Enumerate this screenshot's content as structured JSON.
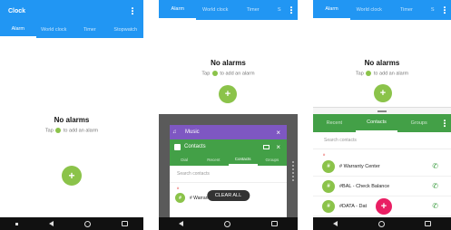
{
  "panel1": {
    "app_title": "Clock",
    "tabs": [
      {
        "label": "Alarm"
      },
      {
        "label": "World clock"
      },
      {
        "label": "Timer"
      },
      {
        "label": "Stopwatch"
      }
    ],
    "empty_title": "No alarms",
    "empty_hint_before": "Tap",
    "empty_hint_after": "to add an alarm",
    "fab_label": "+"
  },
  "panel2": {
    "tabs": [
      {
        "label": "Alarm"
      },
      {
        "label": "World clock"
      },
      {
        "label": "Timer"
      },
      {
        "label": "S"
      }
    ],
    "empty_title": "No alarms",
    "empty_hint_before": "Tap",
    "empty_hint_after": "to add an alarm",
    "fab_label": "+",
    "music_card_title": "Music",
    "contacts_card_title": "Contacts",
    "contacts_tabs": [
      {
        "label": "Dial"
      },
      {
        "label": "Recent"
      },
      {
        "label": "Contacts"
      },
      {
        "label": "Groups"
      }
    ],
    "search_placeholder": "Search contacts",
    "section_letter": "#",
    "first_contact_partial": "# Warran",
    "avatar_letter": "#",
    "clear_all_label": "CLEAR ALL"
  },
  "panel3": {
    "tabs": [
      {
        "label": "Alarm"
      },
      {
        "label": "World clock"
      },
      {
        "label": "Timer"
      },
      {
        "label": "S"
      }
    ],
    "empty_title": "No alarms",
    "empty_hint_before": "Tap",
    "empty_hint_after": "to add an alarm",
    "fab_label": "+",
    "contacts_tabs": [
      {
        "label": "Recent"
      },
      {
        "label": "Contacts"
      },
      {
        "label": "Groups"
      }
    ],
    "search_placeholder": "Search contacts",
    "section_letter": "#",
    "contacts": [
      {
        "avatar": "#",
        "name": "# Warranty Center"
      },
      {
        "avatar": "#",
        "name": "#BAL - Check Balance"
      },
      {
        "avatar": "#",
        "name": "#DATA - Dat"
      }
    ],
    "add_contact_fab": "+"
  },
  "colors": {
    "clock_blue": "#2196f3",
    "contacts_green": "#43a047",
    "fab_green": "#8bc34a",
    "fab_pink": "#e91e63",
    "music_purple": "#7e57c2"
  }
}
